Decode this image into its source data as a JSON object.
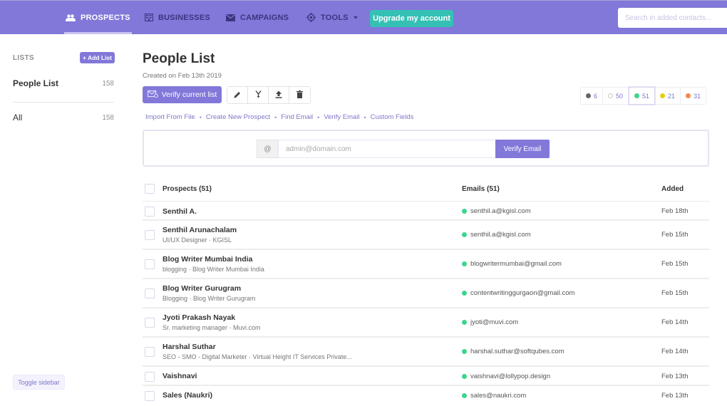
{
  "nav": {
    "items": [
      {
        "label": "PROSPECTS",
        "icon": "people-icon",
        "active": true
      },
      {
        "label": "BUSINESSES",
        "icon": "building-icon",
        "active": false
      },
      {
        "label": "CAMPAIGNS",
        "icon": "envelope-icon",
        "active": false
      },
      {
        "label": "TOOLS",
        "icon": "target-icon",
        "active": false,
        "dropdown": true
      }
    ],
    "upgrade_label": "Upgrade my account",
    "search_placeholder": "Search in added contacts..."
  },
  "sidebar": {
    "lists_label": "LISTS",
    "add_list_label": "+ Add List",
    "items": [
      {
        "name": "People List",
        "count": "158",
        "selected": true
      },
      {
        "name": "All",
        "count": "158",
        "selected": false
      }
    ],
    "toggle_label": "Toggle sidebar"
  },
  "main": {
    "title": "People List",
    "created": "Created on Feb 13th 2019",
    "verify_list_label": "Verify current list",
    "tools": [
      "edit-icon",
      "merge-icon",
      "export-icon",
      "delete-icon"
    ],
    "filters": [
      {
        "count": "6",
        "color": "#666666",
        "status": "unknown"
      },
      {
        "count": "50",
        "color": "#c8c8c8",
        "status": "none",
        "ring": true
      },
      {
        "count": "51",
        "color": "#3cd58c",
        "status": "valid",
        "active": true
      },
      {
        "count": "21",
        "color": "#e5cf10",
        "status": "risky"
      },
      {
        "count": "31",
        "color": "#f4884a",
        "status": "invalid"
      }
    ],
    "links": [
      "Import From File",
      "Create New Prospect",
      "Find Email",
      "Verify Email",
      "Custom Fields"
    ],
    "verify_panel": {
      "at_symbol": "@",
      "placeholder": "admin@domain.com",
      "button_label": "Verify Email"
    }
  },
  "table": {
    "headers": {
      "prospects": "Prospects (51)",
      "emails": "Emails (51)",
      "added": "Added"
    },
    "rows": [
      {
        "name": "Senthil A.",
        "sub": "",
        "email": "senthil.a@kgisl.com",
        "added": "Feb 18th"
      },
      {
        "name": "Senthil Arunachalam",
        "sub": "UI/UX Designer · KGISL",
        "email": "senthil.a@kgisl.com",
        "added": "Feb 15th"
      },
      {
        "name": "Blog Writer Mumbai India",
        "sub": "blogging · Blog Writer Mumbai India",
        "email": "blogwritermumbai@gmail.com",
        "added": "Feb 15th"
      },
      {
        "name": "Blog Writer Gurugram",
        "sub": "Blogging · Blog Writer Gurugram",
        "email": "contentwritinggurgaon@gmail.com",
        "added": "Feb 15th"
      },
      {
        "name": "Jyoti Prakash Nayak",
        "sub": "Sr. marketing manager · Muvi.com",
        "email": "jyoti@muvi.com",
        "added": "Feb 14th"
      },
      {
        "name": "Harshal Suthar",
        "sub": "SEO - SMO - Digital Marketer · Virtual Height IT Services Private...",
        "email": "harshal.suthar@softqubes.com",
        "added": "Feb 14th"
      },
      {
        "name": "Vaishnavi",
        "sub": "",
        "email": "vaishnavi@lollypop.design",
        "added": "Feb 13th"
      },
      {
        "name": "Sales (Naukri)",
        "sub": "",
        "email": "sales@naukri.com",
        "added": "Feb 13th"
      }
    ]
  },
  "colors": {
    "brand": "#8178d9",
    "upgrade": "#35c0b4",
    "valid_dot": "#3cd58c"
  }
}
